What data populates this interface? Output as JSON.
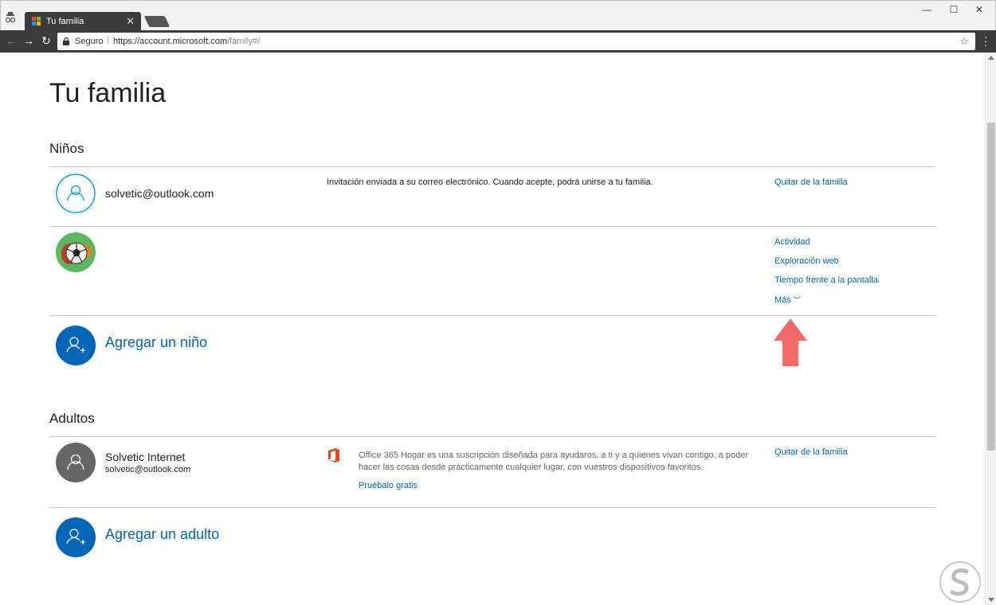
{
  "browser": {
    "tab_title": "Tu familia",
    "tab_close": "✕",
    "window_controls": {
      "minimize": "—",
      "maximize": "☐",
      "close": "✕"
    },
    "security_label": "Seguro",
    "url_host": "https://account.microsoft.com",
    "url_path": "/family#/",
    "icons": {
      "back": "back-arrow-icon",
      "forward": "forward-arrow-icon",
      "reload": "reload-icon",
      "star": "bookmark-star-icon",
      "menu": "menu-dots-icon"
    }
  },
  "page": {
    "title": "Tu familia",
    "children_section": {
      "title": "Niños",
      "members": [
        {
          "email": "solvetic@outlook.com",
          "message": "Invitación enviada a su correo electrónico. Cuando acepte, podrá unirse a tu familia.",
          "actions": [
            "Quitar de la familia"
          ]
        },
        {
          "avatar": "soccer-ball-avatar",
          "actions": [
            "Actividad",
            "Exploración web",
            "Tiempo frente a la pantalla",
            "Más"
          ]
        }
      ],
      "add_label": "Agregar un niño"
    },
    "adults_section": {
      "title": "Adultos",
      "members": [
        {
          "name": "Solvetic Internet",
          "email": "solvetic@outlook.com",
          "office_text": "Office 365 Hogar es una suscripción diseñada para ayudaros, a ti y a quienes vivan contigo, a poder hacer las cosas desde prácticamente cualquier lugar, con vuestros dispositivos favoritos.",
          "office_link": "Pruébalo gratis",
          "actions": [
            "Quitar de la familia"
          ]
        }
      ],
      "add_label": "Agregar un adulto"
    }
  },
  "colors": {
    "accent": "#0067b8",
    "annotation_arrow": "#f26a6a",
    "avatar_outline": "#00a2e8",
    "avatar_dark": "#666666",
    "office": "#e64a19"
  }
}
